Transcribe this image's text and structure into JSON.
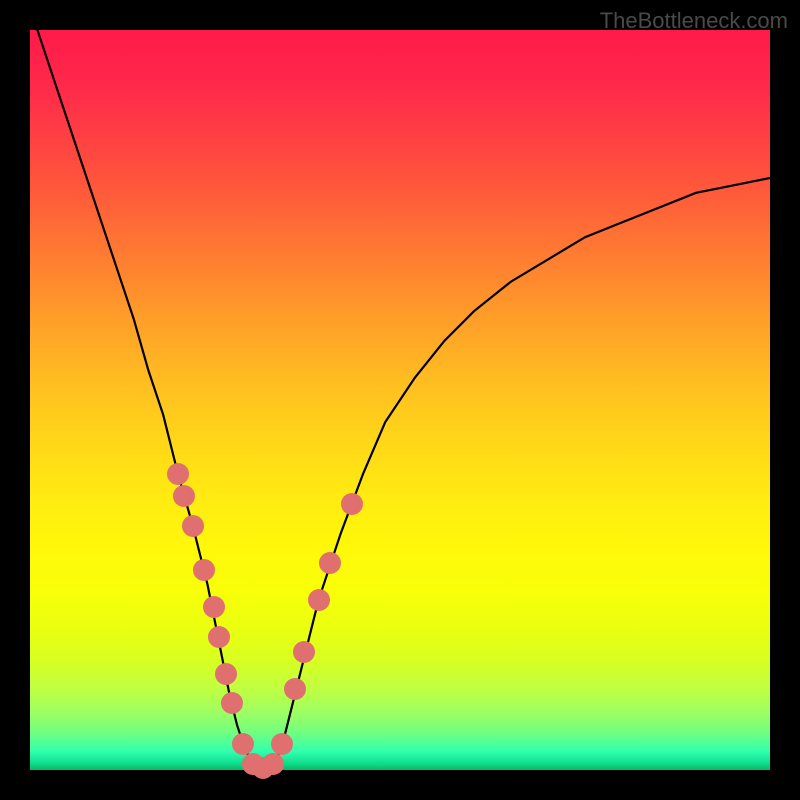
{
  "watermark": "TheBottleneck.com",
  "chart_data": {
    "type": "line",
    "title": "",
    "xlabel": "",
    "ylabel": "",
    "xlim": [
      0,
      100
    ],
    "ylim": [
      0,
      100
    ],
    "series": [
      {
        "name": "curve",
        "x": [
          0,
          2,
          4,
          6,
          8,
          10,
          12,
          14,
          16,
          18,
          20,
          22,
          23,
          24,
          25,
          26,
          27,
          28,
          29,
          30,
          31,
          32,
          33,
          34,
          35,
          37,
          39,
          42,
          45,
          48,
          52,
          56,
          60,
          65,
          70,
          75,
          80,
          85,
          90,
          95,
          100
        ],
        "y": [
          103,
          97,
          91,
          85,
          79,
          73,
          67,
          61,
          54,
          48,
          40,
          33,
          29,
          25,
          20,
          15,
          10,
          6,
          3,
          1,
          0,
          0,
          1,
          3,
          7,
          15,
          23,
          32,
          40,
          47,
          53,
          58,
          62,
          66,
          69,
          72,
          74,
          76,
          78,
          79,
          80
        ]
      }
    ],
    "highlight_dots": [
      {
        "x": 20.0,
        "y": 40
      },
      {
        "x": 20.8,
        "y": 37
      },
      {
        "x": 22.0,
        "y": 33
      },
      {
        "x": 23.5,
        "y": 27
      },
      {
        "x": 24.8,
        "y": 22
      },
      {
        "x": 25.5,
        "y": 18
      },
      {
        "x": 26.5,
        "y": 13
      },
      {
        "x": 27.3,
        "y": 9
      },
      {
        "x": 28.8,
        "y": 3.5
      },
      {
        "x": 30.2,
        "y": 0.8
      },
      {
        "x": 31.5,
        "y": 0.3
      },
      {
        "x": 32.8,
        "y": 0.8
      },
      {
        "x": 34.0,
        "y": 3.5
      },
      {
        "x": 35.8,
        "y": 11
      },
      {
        "x": 37.0,
        "y": 16
      },
      {
        "x": 39.0,
        "y": 23
      },
      {
        "x": 40.5,
        "y": 28
      },
      {
        "x": 43.5,
        "y": 36
      }
    ],
    "gradient_stops": [
      {
        "pos": 0,
        "color": "#ff1a4a"
      },
      {
        "pos": 50,
        "color": "#ffd21a"
      },
      {
        "pos": 100,
        "color": "#08b868"
      }
    ]
  }
}
